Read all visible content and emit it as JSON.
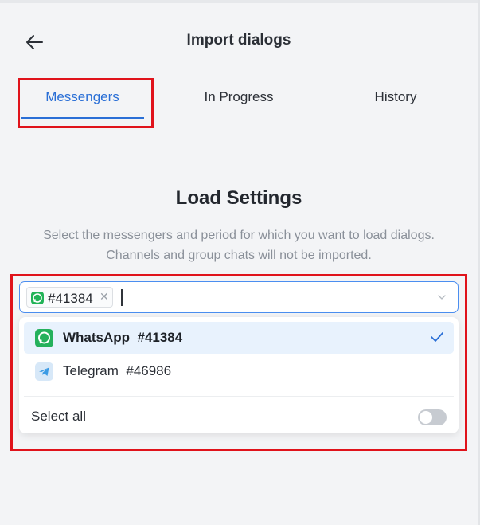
{
  "header": {
    "title": "Import dialogs"
  },
  "tabs": [
    {
      "label": "Messengers",
      "active": true
    },
    {
      "label": "In Progress",
      "active": false
    },
    {
      "label": "History",
      "active": false
    }
  ],
  "load_settings": {
    "title": "Load Settings",
    "description_line1": "Select the messengers and period for which you want to load dialogs.",
    "description_line2": "Channels and group chats will not be imported."
  },
  "select": {
    "chips": [
      {
        "label": "#41384",
        "icon": "whatsapp-icon"
      }
    ],
    "options": [
      {
        "label": "WhatsApp  #41384",
        "icon": "whatsapp-icon",
        "selected": true
      },
      {
        "label": "Telegram  #46986",
        "icon": "telegram-icon",
        "selected": false
      }
    ],
    "select_all_label": "Select all",
    "select_all_enabled": false
  },
  "colors": {
    "accent": "#2a6fd6",
    "highlight": "#e0131b",
    "whatsapp": "#25b15c",
    "telegram": "#3b9be4"
  }
}
